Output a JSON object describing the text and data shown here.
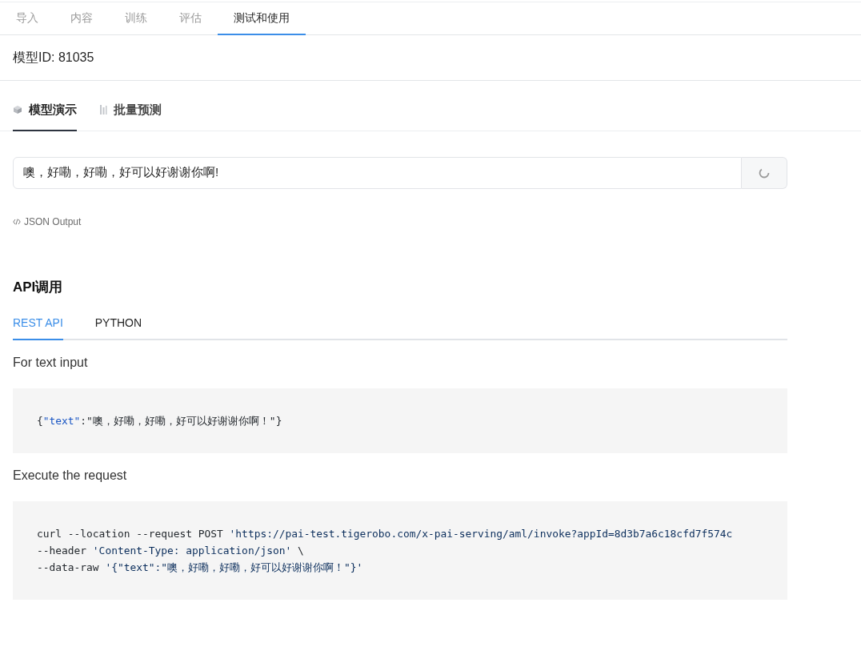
{
  "top_tabs": [
    {
      "label": "导入",
      "selected": false
    },
    {
      "label": "内容",
      "selected": false
    },
    {
      "label": "训练",
      "selected": false
    },
    {
      "label": "评估",
      "selected": false
    },
    {
      "label": "测试和使用",
      "selected": true
    }
  ],
  "model_id": "模型ID: 81035",
  "demo_tabs": [
    {
      "label": "模型演示",
      "kind": "cube",
      "selected": true
    },
    {
      "label": "批量预测",
      "kind": "bars",
      "selected": false
    }
  ],
  "input": {
    "value": "噢，好嘞，好嘞，好可以好谢谢你啊!",
    "loading": true
  },
  "json_output_link": "JSON Output",
  "api": {
    "title": "API调用",
    "tabs": [
      {
        "label": "REST API",
        "selected": true
      },
      {
        "label": "PYTHON",
        "selected": false
      }
    ],
    "sections": [
      {
        "label": "For text input",
        "lines": [
          [
            {
              "text": "{",
              "kind": "plain"
            },
            {
              "text": "\"text\"",
              "kind": "key"
            },
            {
              "text": ":\"噢，好嘞，好嘞，好可以好谢谢你啊！\"}",
              "kind": "plain"
            }
          ]
        ]
      },
      {
        "label": "Execute the request",
        "lines": [
          [
            {
              "text": "curl --location --request POST ",
              "kind": "plain"
            },
            {
              "text": "'https://pai-test.tigerobo.com/x-pai-serving/aml/invoke?appId=8d3b7a6c18cfd7f574c",
              "kind": "string"
            }
          ],
          [
            {
              "text": "--header ",
              "kind": "plain"
            },
            {
              "text": "'Content-Type: application/json'",
              "kind": "string"
            },
            {
              "text": " \\",
              "kind": "plain"
            }
          ],
          [
            {
              "text": "--data-raw ",
              "kind": "plain"
            },
            {
              "text": "'{\"text\":\"噢，好嘞，好嘞，好可以好谢谢你啊！\"}'",
              "kind": "string"
            }
          ]
        ]
      }
    ]
  }
}
